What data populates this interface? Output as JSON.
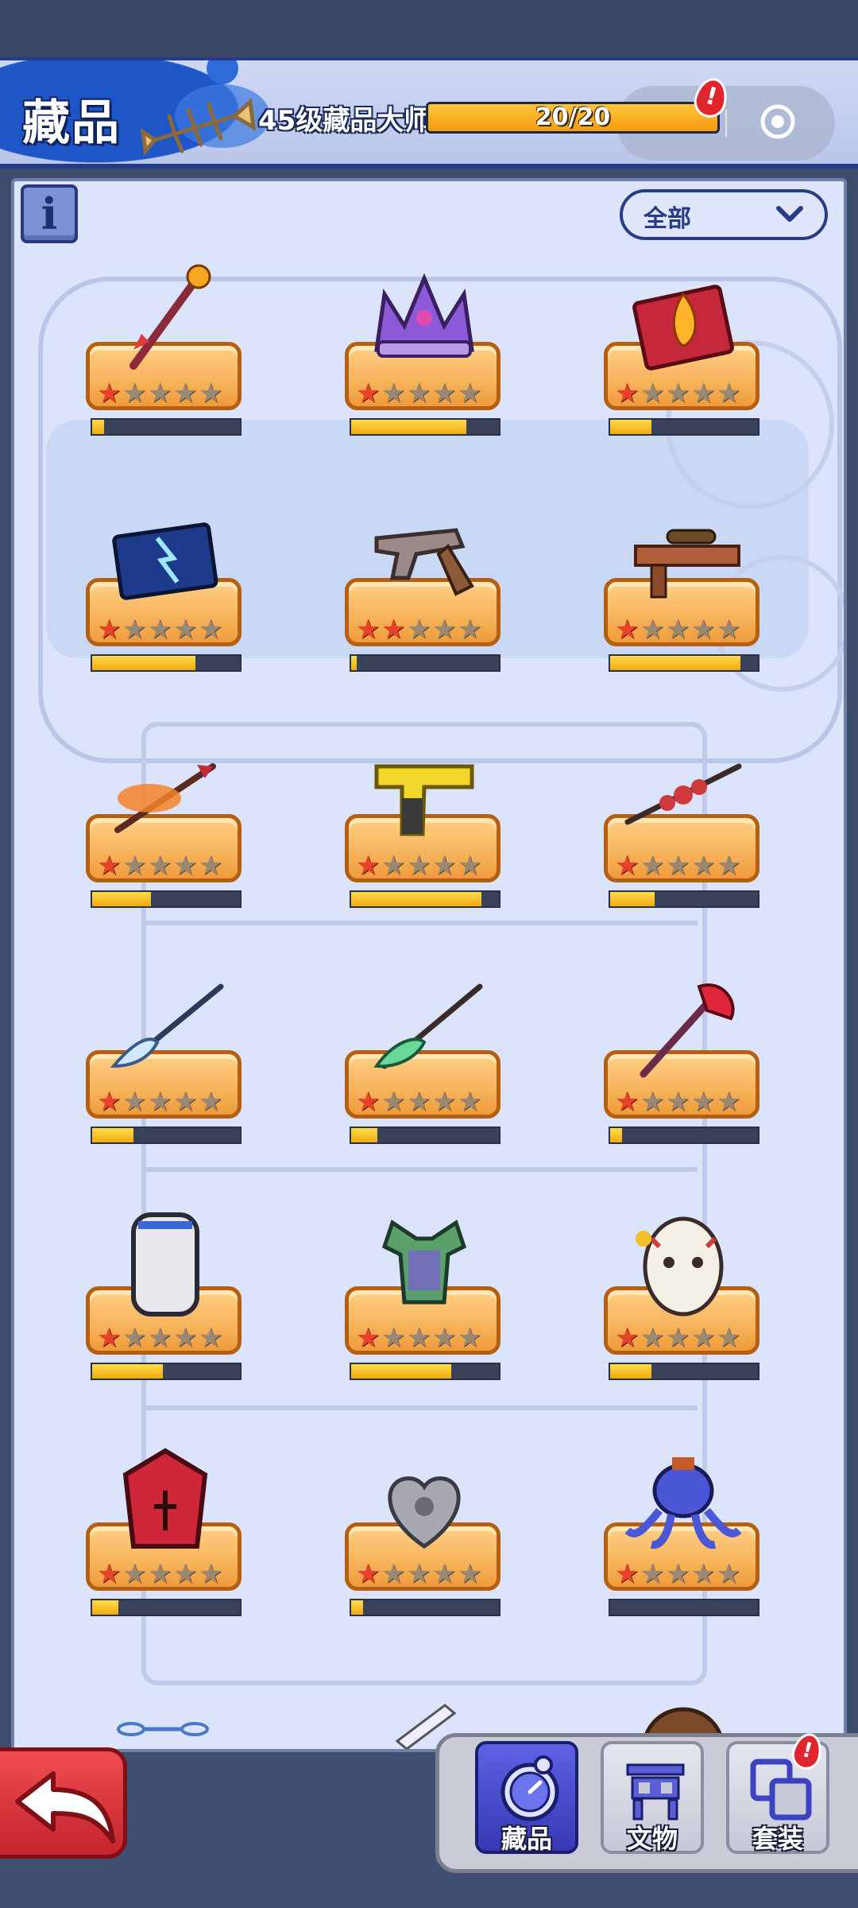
{
  "header": {
    "title": "藏品",
    "level_label": "45级藏品大师",
    "progress_text": "20/20",
    "progress_fraction": 1.0,
    "menu_icon": "more-dots-icon",
    "close_icon": "target-circle-icon"
  },
  "toolbar": {
    "info_label": "i",
    "filter_label": "全部"
  },
  "items": [
    {
      "name": "fire-scepter",
      "stars": 1,
      "progress": 0.08
    },
    {
      "name": "purple-crown",
      "stars": 1,
      "progress": 0.78
    },
    {
      "name": "flame-book",
      "stars": 1,
      "progress": 0.28
    },
    {
      "name": "lightning-book",
      "stars": 1,
      "progress": 0.7
    },
    {
      "name": "revolver",
      "stars": 2,
      "progress": 0.04
    },
    {
      "name": "sniper-rifle",
      "stars": 1,
      "progress": 0.88
    },
    {
      "name": "fire-arrow",
      "stars": 1,
      "progress": 0.4
    },
    {
      "name": "golden-pistol",
      "stars": 1,
      "progress": 0.88
    },
    {
      "name": "thorn-spear",
      "stars": 1,
      "progress": 0.3
    },
    {
      "name": "ice-glaive",
      "stars": 1,
      "progress": 0.28
    },
    {
      "name": "jade-glaive",
      "stars": 1,
      "progress": 0.18
    },
    {
      "name": "crimson-axe",
      "stars": 1,
      "progress": 0.08
    },
    {
      "name": "police-shield",
      "stars": 1,
      "progress": 0.48
    },
    {
      "name": "green-armor",
      "stars": 1,
      "progress": 0.68
    },
    {
      "name": "hockey-mask",
      "stars": 1,
      "progress": 0.28
    },
    {
      "name": "red-coffin-shield",
      "stars": 1,
      "progress": 0.18
    },
    {
      "name": "mechanical-heart",
      "stars": 1,
      "progress": 0.08
    },
    {
      "name": "octopus-guitarist",
      "stars": 1,
      "progress": 0.0
    }
  ],
  "star_total": 5,
  "tabs": [
    {
      "label": "藏品",
      "icon": "compass-clock-icon",
      "active": true
    },
    {
      "label": "文物",
      "icon": "shrine-icon",
      "active": false
    },
    {
      "label": "套装",
      "icon": "stacked-squares-icon",
      "active": false
    }
  ],
  "colors": {
    "accent": "#283c86",
    "plate": "#f7b35a",
    "progress_fill": "#f2a812",
    "alert": "#e0262c"
  }
}
